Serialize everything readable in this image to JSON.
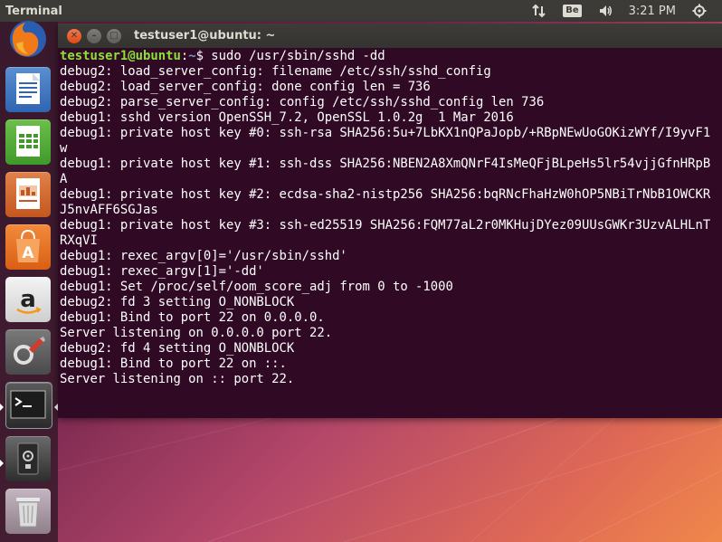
{
  "top_panel": {
    "app_title": "Terminal",
    "keyboard_layout": "Be",
    "clock": "3:21 PM",
    "icons": [
      "network-arrows-icon",
      "volume-icon",
      "power-gear-icon"
    ]
  },
  "launcher": {
    "items": [
      {
        "name": "firefox",
        "icon": "firefox-icon"
      },
      {
        "name": "libreoffice-writer",
        "icon": "writer-icon"
      },
      {
        "name": "libreoffice-calc",
        "icon": "calc-icon"
      },
      {
        "name": "libreoffice-impress",
        "icon": "impress-icon"
      },
      {
        "name": "ubuntu-software",
        "icon": "software-center-icon"
      },
      {
        "name": "amazon",
        "icon": "amazon-icon"
      },
      {
        "name": "system-settings",
        "icon": "settings-icon"
      },
      {
        "name": "terminal",
        "icon": "terminal-icon",
        "active": true
      },
      {
        "name": "disk-drive",
        "icon": "drive-icon"
      },
      {
        "name": "trash",
        "icon": "trash-icon"
      }
    ]
  },
  "terminal": {
    "title": "testuser1@ubuntu: ~",
    "prompt_user": "testuser1@ubuntu",
    "prompt_sep": ":",
    "prompt_path": "~",
    "prompt_symbol": "$ ",
    "command": "sudo /usr/sbin/sshd -dd",
    "output": "debug2: load_server_config: filename /etc/ssh/sshd_config\ndebug2: load_server_config: done config len = 736\ndebug2: parse_server_config: config /etc/ssh/sshd_config len 736\ndebug1: sshd version OpenSSH_7.2, OpenSSL 1.0.2g  1 Mar 2016\ndebug1: private host key #0: ssh-rsa SHA256:5u+7LbKX1nQPaJopb/+RBpNEwUoGOKizWYf/I9yvF1w\ndebug1: private host key #1: ssh-dss SHA256:NBEN2A8XmQNrF4IsMeQFjBLpeHs5lr54vjjGfnHRpBA\ndebug1: private host key #2: ecdsa-sha2-nistp256 SHA256:bqRNcFhaHzW0hOP5NBiTrNbB1OWCKRJ5nvAFF6SGJas\ndebug1: private host key #3: ssh-ed25519 SHA256:FQM77aL2r0MKHujDYez09UUsGWKr3UzvALHLnTRXqVI\ndebug1: rexec_argv[0]='/usr/sbin/sshd'\ndebug1: rexec_argv[1]='-dd'\ndebug1: Set /proc/self/oom_score_adj from 0 to -1000\ndebug2: fd 3 setting O_NONBLOCK\ndebug1: Bind to port 22 on 0.0.0.0.\nServer listening on 0.0.0.0 port 22.\ndebug2: fd 4 setting O_NONBLOCK\ndebug1: Bind to port 22 on ::.\nServer listening on :: port 22."
  },
  "colors": {
    "terminal_bg": "#300a24",
    "prompt_user": "#8ae234",
    "prompt_path": "#729fcf",
    "panel_bg": "#3c3b37"
  }
}
